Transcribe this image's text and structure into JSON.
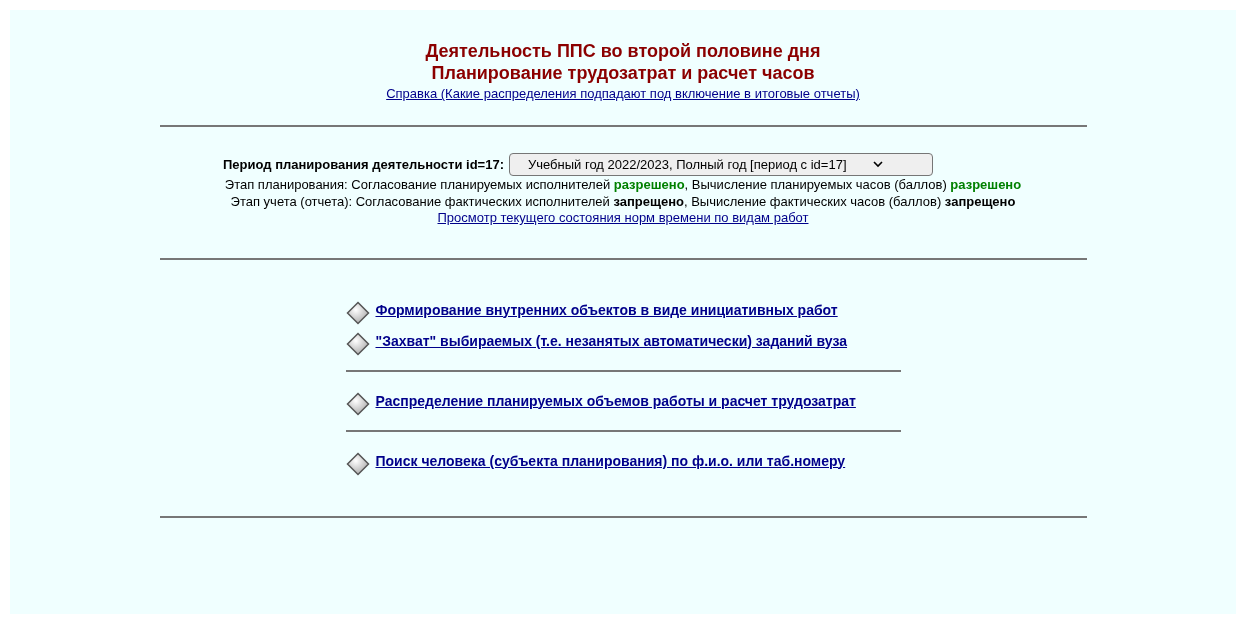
{
  "header": {
    "title_lines": [
      "Деятельность ППС во второй половине дня",
      "Планирование трудозатрат и расчет часов"
    ],
    "help_link": "Справка (Какие распределения подпадают под включение в итоговые отчеты)"
  },
  "period": {
    "label": "Период планирования деятельности id=17:",
    "value": "Учебный год 2022/2023, Полный год [период с id=17]"
  },
  "stages": [
    {
      "label": "Этап планирования: ",
      "items": [
        {
          "text": "Согласование планируемых исполнителей ",
          "status": "разрешено",
          "allowed": true
        },
        {
          "text": ", Вычисление планируемых часов (баллов) ",
          "status": "разрешено",
          "allowed": true
        }
      ]
    },
    {
      "label": "Этап учета (отчета): ",
      "items": [
        {
          "text": "Согласование фактических исполнителей ",
          "status": "запрещено",
          "allowed": false
        },
        {
          "text": ", Вычисление фактических часов (баллов) ",
          "status": "запрещено",
          "allowed": false
        }
      ]
    }
  ],
  "norms_link": "Просмотр текущего состояния норм времени по видам работ",
  "menu_groups": [
    [
      "Формирование внутренних объектов в виде инициативных работ",
      "\"Захват\" выбираемых (т.е. незанятых автоматически) заданий вуза"
    ],
    [
      "Распределение планируемых объемов работы и расчет трудозатрат"
    ],
    [
      "Поиск человека (субъекта планирования) по ф.и.о. или таб.номеру"
    ]
  ]
}
